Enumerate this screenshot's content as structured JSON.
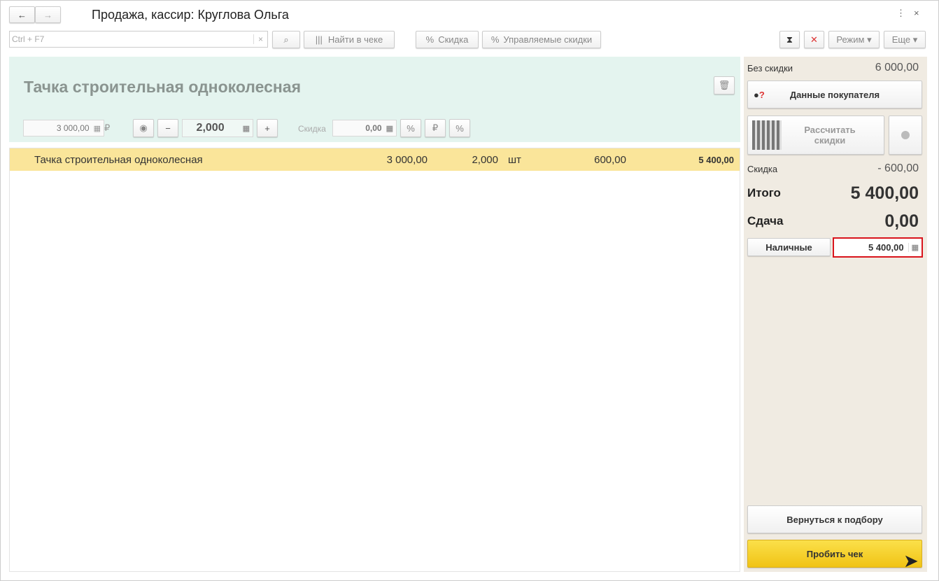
{
  "title": "Продажа, кассир: Круглова Ольга",
  "search": {
    "placeholder": "Ctrl + F7",
    "clear": "×"
  },
  "toolbar": {
    "find": "Найти в чеке",
    "discount": "Скидка",
    "managed": "Управляемые скидки",
    "mode": "Режим",
    "more": "Еще"
  },
  "item": {
    "name": "Тачка строительная одноколесная",
    "price": "3 000,00",
    "currency": "₽",
    "qty": "2,000",
    "discount_label": "Скидка",
    "discount": "0,00"
  },
  "rows": [
    {
      "name": "Тачка строительная одноколесная",
      "price": "3 000,00",
      "qty": "2,000",
      "unit": "шт",
      "discount": "600,00",
      "sum": "5 400,00"
    }
  ],
  "summary": {
    "no_discount_label": "Без скидки",
    "no_discount": "6 000,00",
    "customer": "Данные покупателя",
    "calc": "Рассчитать скидки",
    "discount_label": "Скидка",
    "discount": "- 600,00",
    "total_label": "Итого",
    "total": "5 400,00",
    "change_label": "Сдача",
    "change": "0,00",
    "cash": "Наличные",
    "cash_value": "5 400,00",
    "back": "Вернуться к подбору",
    "print": "Пробить чек"
  }
}
